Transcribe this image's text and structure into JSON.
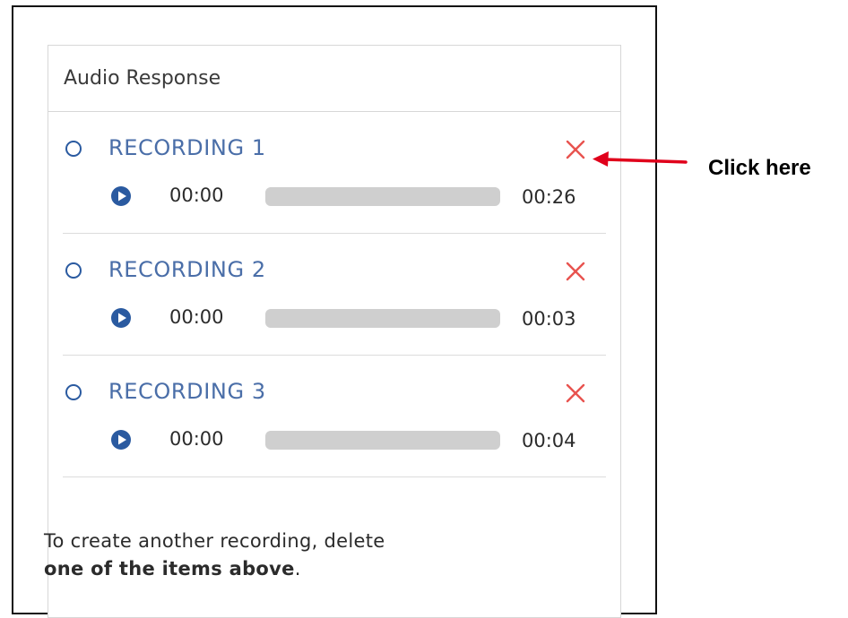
{
  "panel": {
    "title": "Audio Response"
  },
  "recordings": [
    {
      "title": "RECORDING 1",
      "current_time": "00:00",
      "duration": "00:26",
      "progress": 0
    },
    {
      "title": "RECORDING 2",
      "current_time": "00:00",
      "duration": "00:03",
      "progress": 0
    },
    {
      "title": "RECORDING 3",
      "current_time": "00:00",
      "duration": "00:04",
      "progress": 0
    }
  ],
  "footer": {
    "text_before": "To create another recording, delete ",
    "text_bold": "one of the items above",
    "text_after": "."
  },
  "annotation": {
    "callout": "Click here"
  },
  "colors": {
    "accent": "#4a6ea8",
    "delete": "#e8534f",
    "arrow": "#e0001b",
    "track": "#cfcfcf"
  },
  "icons": {
    "radio": "radio-icon",
    "play": "play-icon",
    "delete": "close-icon",
    "arrow": "arrow-left-icon"
  }
}
